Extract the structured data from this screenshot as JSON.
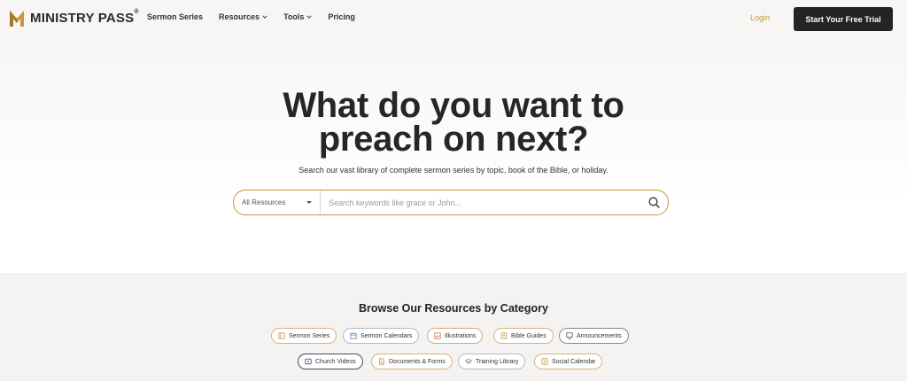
{
  "nav": {
    "logo_text": "MINISTRY PASS",
    "logo_mark": "®",
    "menu": [
      {
        "label": "Sermon Series",
        "has_dropdown": false
      },
      {
        "label": "Resources",
        "has_dropdown": true
      },
      {
        "label": "Tools",
        "has_dropdown": true
      },
      {
        "label": "Pricing",
        "has_dropdown": false
      }
    ],
    "login_label": "Login",
    "trial_label": "Start Your Free Trial"
  },
  "hero": {
    "headline_line1": "What do you want to",
    "headline_line2": "preach on next?",
    "subtitle": "Search our vast library of complete sermon series by topic, book of the Bible, or holiday.",
    "search": {
      "select_value": "All Resources",
      "placeholder": "Search keywords like grace or John...",
      "icon": "search-icon"
    }
  },
  "browse": {
    "title": "Browse Our Resources by Category",
    "categories": [
      {
        "label": "Sermon Series",
        "icon": "book-icon",
        "color": "#c8963e"
      },
      {
        "label": "Sermon Calendars",
        "icon": "calendar-icon",
        "color": "#6b8fb0"
      },
      {
        "label": "Illustrations",
        "icon": "image-icon",
        "color": "#c87a4a"
      },
      {
        "label": "Bible Guides",
        "icon": "bible-icon",
        "color": "#c8963e"
      },
      {
        "label": "Announcements",
        "icon": "presentation-icon",
        "color": "#555555"
      },
      {
        "label": "Church Videos",
        "icon": "video-icon",
        "color": "#3a4f6a"
      },
      {
        "label": "Documents & Forms",
        "icon": "document-icon",
        "color": "#c8963e"
      },
      {
        "label": "Training Library",
        "icon": "graduation-cap-icon",
        "color": "#999999"
      },
      {
        "label": "Social Calendar",
        "icon": "social-calendar-icon",
        "color": "#c8963e"
      }
    ]
  },
  "colors": {
    "accent": "#c8963e",
    "dark": "#242424",
    "background": "#f7f6f4"
  }
}
